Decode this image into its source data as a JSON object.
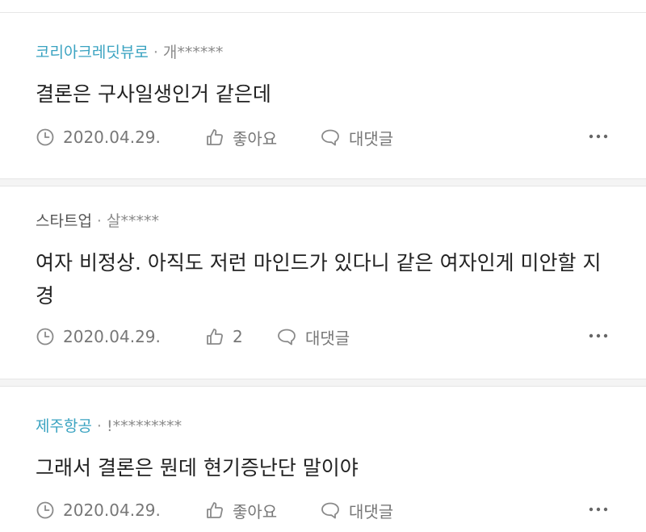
{
  "comments": [
    {
      "company": "코리아크레딧뷰로",
      "separator": "·",
      "user": "개******",
      "text": "결론은 구사일생인거 같은데",
      "date": "2020.04.29.",
      "like_label": "좋아요",
      "reply_label": "대댓글"
    },
    {
      "company": "스타트업",
      "separator": "·",
      "user": "살*****",
      "text": "여자 비정상. 아직도 저런 마인드가 있다니 같은 여자인게 미안할 지경",
      "date": "2020.04.29.",
      "like_label": "2",
      "reply_label": "대댓글"
    },
    {
      "company": "제주항공",
      "separator": "·",
      "user": "!*********",
      "text": "그래서 결론은 뭔데 현기증난단 말이야",
      "date": "2020.04.29.",
      "like_label": "좋아요",
      "reply_label": "대댓글"
    }
  ],
  "colors": {
    "company_accent": "#3aa3c1",
    "meta_gray": "#777777"
  },
  "icons": [
    "clock-icon",
    "thumbs-up-icon",
    "speech-bubble-icon",
    "more-icon"
  ]
}
